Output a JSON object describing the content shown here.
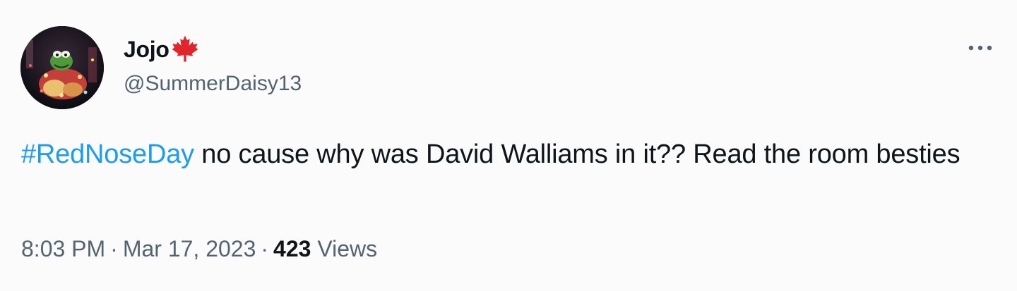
{
  "author": {
    "display_name": "Jojo",
    "badge_icon": "maple-leaf-icon",
    "badge_color": "#e0262a",
    "handle": "@SummerDaisy13"
  },
  "tweet": {
    "hashtag": "#RedNoseDay",
    "text": " no cause why was David Walliams in it?? Read the room besties",
    "hashtag_color": "#1d9bf0"
  },
  "meta": {
    "time": "8:03 PM",
    "separator": "·",
    "date": "Mar 17, 2023",
    "views_count": "423",
    "views_label": "Views"
  },
  "more_icon": "more-options-icon"
}
